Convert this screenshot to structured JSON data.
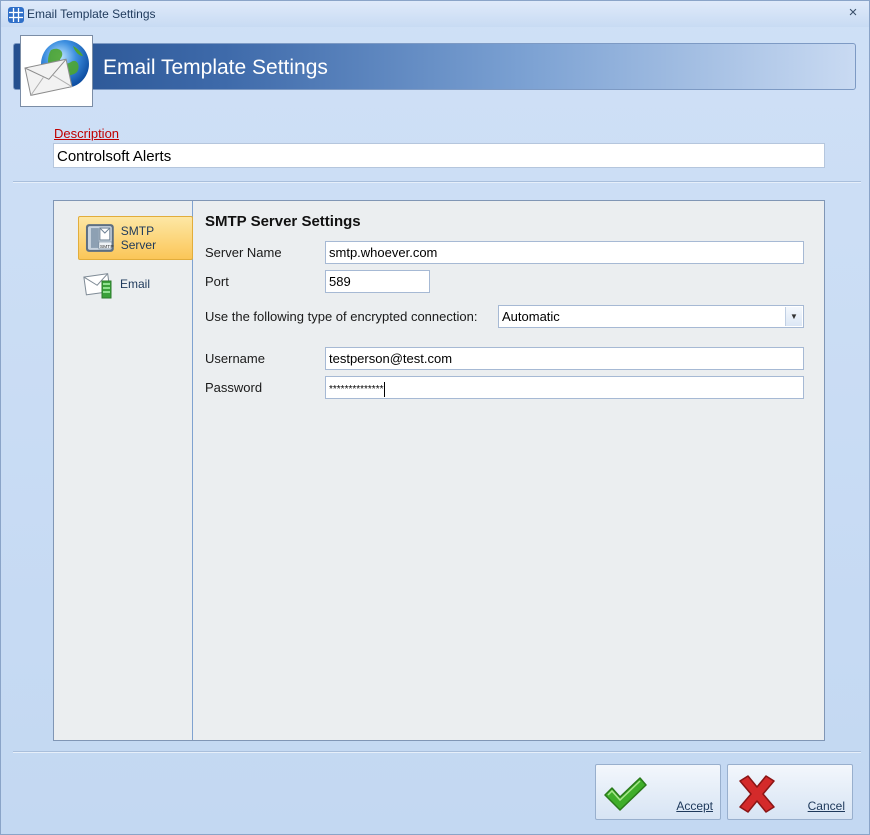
{
  "window": {
    "title": "Email Template Settings",
    "close_glyph": "×"
  },
  "banner": {
    "title": "Email Template Settings",
    "icon": "globe-mail-icon"
  },
  "description": {
    "label": "Description",
    "value": "Controlsoft Alerts"
  },
  "nav": {
    "items": [
      {
        "label": "SMTP Server",
        "icon": "smtp-server-icon",
        "selected": true
      },
      {
        "label": "Email",
        "icon": "email-icon",
        "selected": false
      }
    ]
  },
  "smtp": {
    "section_title": "SMTP Server Settings",
    "server_name_label": "Server Name",
    "server_name_value": "smtp.whoever.com",
    "port_label": "Port",
    "port_value": "589",
    "encryption_label": "Use the following type of encrypted connection:",
    "encryption_value": "Automatic",
    "username_label": "Username",
    "username_value": "testperson@test.com",
    "password_label": "Password",
    "password_value": "**************"
  },
  "buttons": {
    "accept_label": "Accept",
    "cancel_label": "Cancel"
  },
  "colors": {
    "accent_banner": "#25508f",
    "required_label": "#c00000",
    "selected_nav": "#fbc658",
    "accept_check": "#3fae2a",
    "cancel_x": "#d42a2a"
  }
}
